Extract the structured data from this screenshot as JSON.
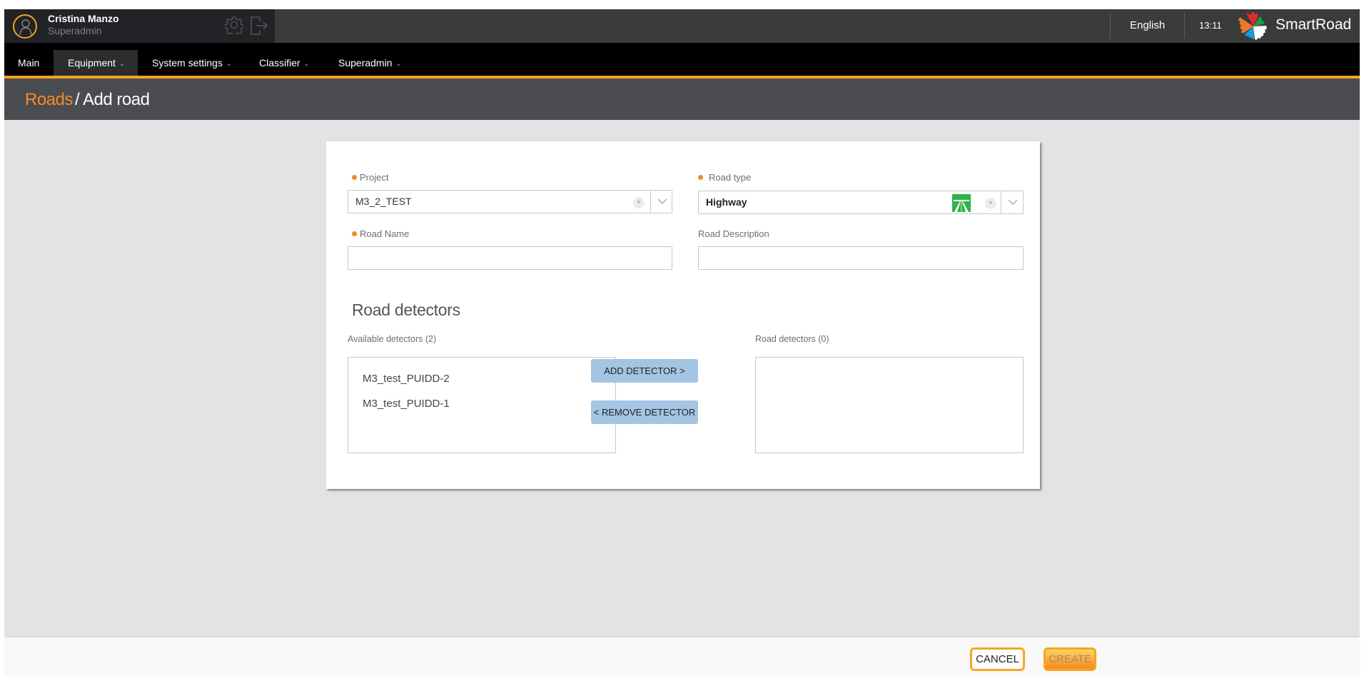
{
  "header": {
    "user_name": "Cristina Manzo",
    "user_role": "Superadmin",
    "language": "English",
    "time": "13:11",
    "brand": "SmartRoad"
  },
  "nav": {
    "items": [
      {
        "label": "Main",
        "has_dropdown": false,
        "active": false
      },
      {
        "label": "Equipment",
        "has_dropdown": true,
        "active": true
      },
      {
        "label": "System settings",
        "has_dropdown": true,
        "active": false
      },
      {
        "label": "Classifier",
        "has_dropdown": true,
        "active": false
      },
      {
        "label": "Superadmin",
        "has_dropdown": true,
        "active": false
      }
    ],
    "chevron": "⌄"
  },
  "breadcrumb": {
    "parent": "Roads",
    "separator": "/",
    "current": "Add road",
    "current_full": "/ Add road"
  },
  "form": {
    "project": {
      "label": "Project",
      "required": true,
      "value": "M3_2_TEST"
    },
    "road_type": {
      "label": "Road type",
      "required": true,
      "value": "Highway",
      "icon": "highway-icon"
    },
    "road_name": {
      "label": "Road Name",
      "required": true,
      "value": "",
      "placeholder": ""
    },
    "road_description": {
      "label": "Road Description",
      "required": false,
      "value": "",
      "placeholder": ""
    },
    "clear_glyph": "×"
  },
  "detectors": {
    "section_title": "Road detectors",
    "available_label": "Available detectors (2)",
    "assigned_label": "Road detectors (0)",
    "available": [
      "M3_test_PUIDD-2",
      "M3_test_PUIDD-1"
    ],
    "assigned": [],
    "add_button": "ADD DETECTOR >",
    "remove_button": "< REMOVE DETECTOR"
  },
  "footer": {
    "cancel": "CANCEL",
    "create": "CREATE",
    "create_enabled": false
  },
  "colors": {
    "accent": "#f28c28",
    "nav_underline": "#f4a21f",
    "header_bg": "#3a3b3a",
    "titlebar_bg": "#4b4c51",
    "detector_button_bg": "#a3c5e3",
    "highway_green": "#2fb34a"
  }
}
